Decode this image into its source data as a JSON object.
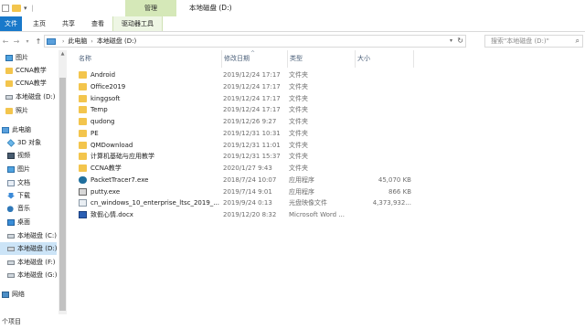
{
  "window": {
    "manage_tab": "管理",
    "title": "本地磁盘 (D:)"
  },
  "ribbon": {
    "tabs": [
      "文件",
      "主页",
      "共享",
      "查看",
      "驱动器工具"
    ]
  },
  "address": {
    "crumbs": [
      "此电脑",
      "本地磁盘 (D:)"
    ],
    "search_placeholder": "搜索\"本地磁盘 (D:)\""
  },
  "nav": {
    "items": [
      {
        "label": "图片",
        "icon": "pictures-icon"
      },
      {
        "label": "CCNA教学",
        "icon": "folder-icon"
      },
      {
        "label": "CCNA教学",
        "icon": "folder-icon"
      },
      {
        "label": "本地磁盘 (D:)",
        "icon": "drive-icon"
      },
      {
        "label": "照片",
        "icon": "folder-icon"
      },
      {
        "label": "此电脑",
        "icon": "computer-icon"
      },
      {
        "label": "3D 对象",
        "icon": "3d-objects-icon"
      },
      {
        "label": "视频",
        "icon": "video-icon"
      },
      {
        "label": "图片",
        "icon": "pictures-icon"
      },
      {
        "label": "文档",
        "icon": "documents-icon"
      },
      {
        "label": "下载",
        "icon": "download-icon"
      },
      {
        "label": "音乐",
        "icon": "music-icon"
      },
      {
        "label": "桌面",
        "icon": "desktop-icon"
      },
      {
        "label": "本地磁盘 (C:)",
        "icon": "drive-icon"
      },
      {
        "label": "本地磁盘 (D:)",
        "icon": "drive-icon",
        "selected": true
      },
      {
        "label": "本地磁盘 (F:)",
        "icon": "drive-icon"
      },
      {
        "label": "本地磁盘 (G:)",
        "icon": "drive-icon"
      },
      {
        "label": "网络",
        "icon": "network-icon"
      }
    ]
  },
  "columns": {
    "name": "名称",
    "date": "修改日期",
    "type": "类型",
    "size": "大小"
  },
  "files": [
    {
      "name": "Android",
      "date": "2019/12/24 17:17",
      "type": "文件夹",
      "size": "",
      "icon": "folder-icon"
    },
    {
      "name": "Office2019",
      "date": "2019/12/24 17:17",
      "type": "文件夹",
      "size": "",
      "icon": "folder-icon"
    },
    {
      "name": "kinggsoft",
      "date": "2019/12/24 17:17",
      "type": "文件夹",
      "size": "",
      "icon": "folder-icon"
    },
    {
      "name": "Temp",
      "date": "2019/12/24 17:17",
      "type": "文件夹",
      "size": "",
      "icon": "folder-icon"
    },
    {
      "name": "qudong",
      "date": "2019/12/26 9:27",
      "type": "文件夹",
      "size": "",
      "icon": "folder-icon"
    },
    {
      "name": "PE",
      "date": "2019/12/31 10:31",
      "type": "文件夹",
      "size": "",
      "icon": "folder-icon"
    },
    {
      "name": "QMDownload",
      "date": "2019/12/31 11:01",
      "type": "文件夹",
      "size": "",
      "icon": "folder-icon"
    },
    {
      "name": "计算机基础与应用教学",
      "date": "2019/12/31 15:37",
      "type": "文件夹",
      "size": "",
      "icon": "folder-icon"
    },
    {
      "name": "CCNA教学",
      "date": "2020/1/27 9:43",
      "type": "文件夹",
      "size": "",
      "icon": "folder-icon"
    },
    {
      "name": "PacketTracer7.exe",
      "date": "2018/7/24 10:07",
      "type": "应用程序",
      "size": "45,070 KB",
      "icon": "packet-tracer-icon"
    },
    {
      "name": "putty.exe",
      "date": "2019/7/14 9:01",
      "type": "应用程序",
      "size": "866 KB",
      "icon": "putty-icon"
    },
    {
      "name": "cn_windows_10_enterprise_ltsc_2019_...",
      "date": "2019/9/24 0:13",
      "type": "光盘映像文件",
      "size": "4,373,932...",
      "icon": "disc-image-icon"
    },
    {
      "name": "致假心情.docx",
      "date": "2019/12/20 8:32",
      "type": "Microsoft Word ...",
      "size": "",
      "icon": "word-document-icon"
    }
  ],
  "status": {
    "item_count": "个项目"
  }
}
